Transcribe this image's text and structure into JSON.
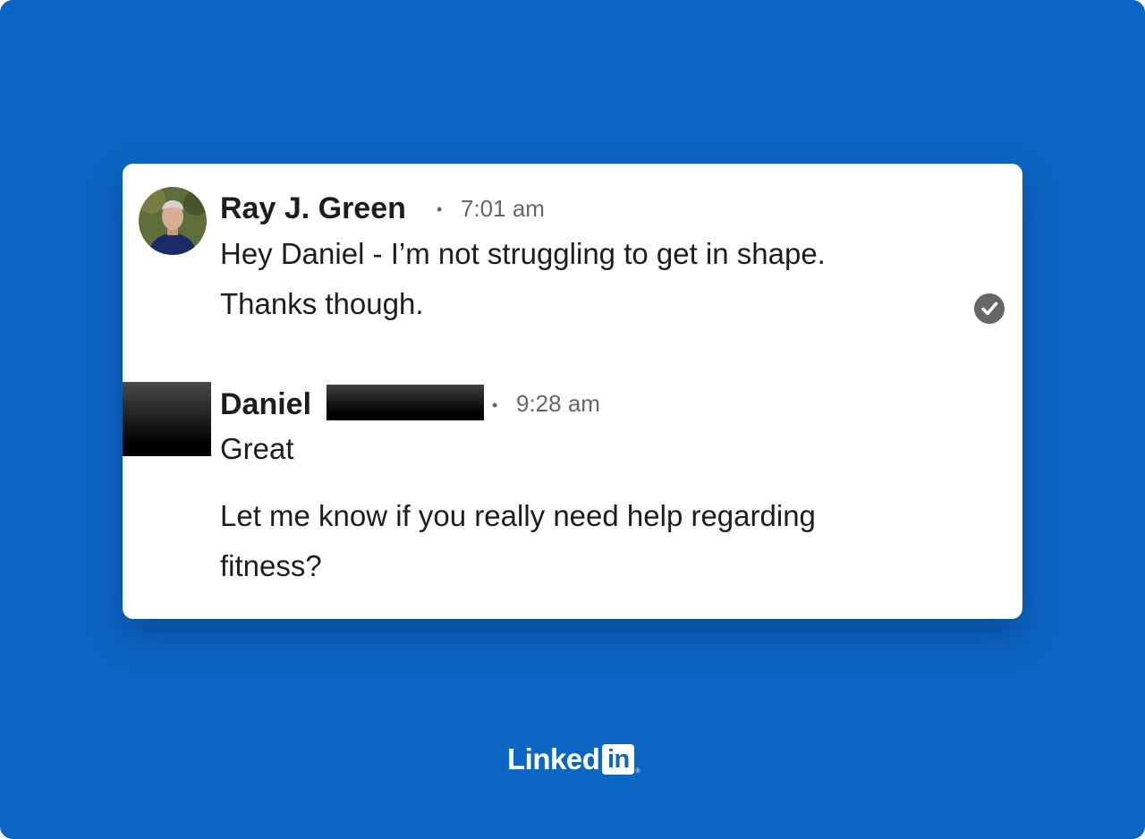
{
  "brand": {
    "logo_word": "Linked",
    "logo_box": "in",
    "registered": "®",
    "background_color": "#0b66c3"
  },
  "messages": [
    {
      "sender": "Ray J. Green",
      "separator": "•",
      "time": "7:01 am",
      "lines": [
        "Hey Daniel - I’m not struggling to get in shape.",
        "Thanks though."
      ],
      "read_receipt_icon": "check-circle-icon"
    },
    {
      "sender": "Daniel",
      "separator": "•",
      "time": "9:28 am",
      "lines": [
        "Great",
        "Let me know if you really need help regarding",
        "fitness?"
      ]
    }
  ]
}
